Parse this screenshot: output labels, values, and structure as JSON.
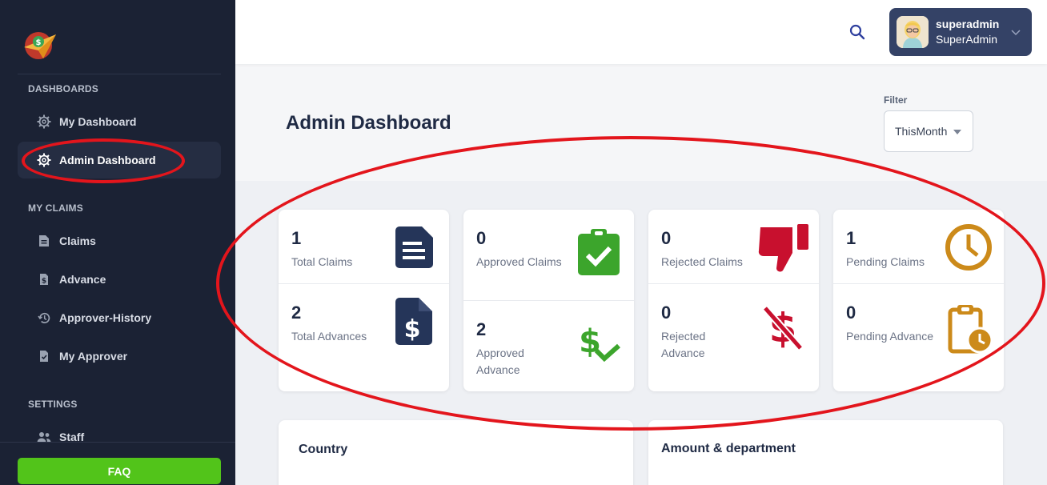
{
  "sidebar": {
    "sections": [
      {
        "title": "DASHBOARDS"
      },
      {
        "title": "MY CLAIMS"
      },
      {
        "title": "SETTINGS"
      }
    ],
    "items": [
      {
        "label": "My Dashboard",
        "icon": "gear-icon"
      },
      {
        "label": "Admin Dashboard",
        "icon": "gear-icon",
        "active": true
      },
      {
        "label": "Claims",
        "icon": "document-icon"
      },
      {
        "label": "Advance",
        "icon": "dollar-document-icon"
      },
      {
        "label": "Approver-History",
        "icon": "history-icon"
      },
      {
        "label": "My Approver",
        "icon": "check-document-icon"
      },
      {
        "label": "Staff",
        "icon": "users-icon"
      }
    ],
    "faq_label": "FAQ"
  },
  "topbar": {
    "user": {
      "name": "superadmin",
      "role": "SuperAdmin"
    }
  },
  "header": {
    "title": "Admin Dashboard",
    "filter_label": "Filter",
    "filter_value": "ThisMonth"
  },
  "cards": [
    {
      "top": {
        "value": "1",
        "label": "Total Claims",
        "icon": "document-icon",
        "color": "#253559"
      },
      "bottom": {
        "value": "2",
        "label": "Total Advances",
        "icon": "dollar-document-icon",
        "color": "#253559"
      }
    },
    {
      "top": {
        "value": "0",
        "label": "Approved Claims",
        "icon": "clipboard-check-icon",
        "color": "#3ca52c"
      },
      "bottom": {
        "value": "2",
        "label": "Approved Advance",
        "icon": "dollar-check-icon",
        "color": "#3ca52c"
      }
    },
    {
      "top": {
        "value": "0",
        "label": "Rejected Claims",
        "icon": "thumbs-down-icon",
        "color": "#c8102e"
      },
      "bottom": {
        "value": "0",
        "label": "Rejected Advance",
        "icon": "no-dollar-icon",
        "color": "#c8102e"
      }
    },
    {
      "top": {
        "value": "1",
        "label": "Pending Claims",
        "icon": "clock-icon",
        "color": "#cc8a1a"
      },
      "bottom": {
        "value": "0",
        "label": "Pending Advance",
        "icon": "clipboard-clock-icon",
        "color": "#cc8a1a"
      }
    }
  ],
  "panels": [
    {
      "title": "Country"
    },
    {
      "title": "Amount & department"
    }
  ],
  "colors": {
    "sidebar_bg": "#1b2234",
    "faq_green": "#52c41a",
    "user_box": "#344266",
    "annotation_red": "#e3151c"
  }
}
